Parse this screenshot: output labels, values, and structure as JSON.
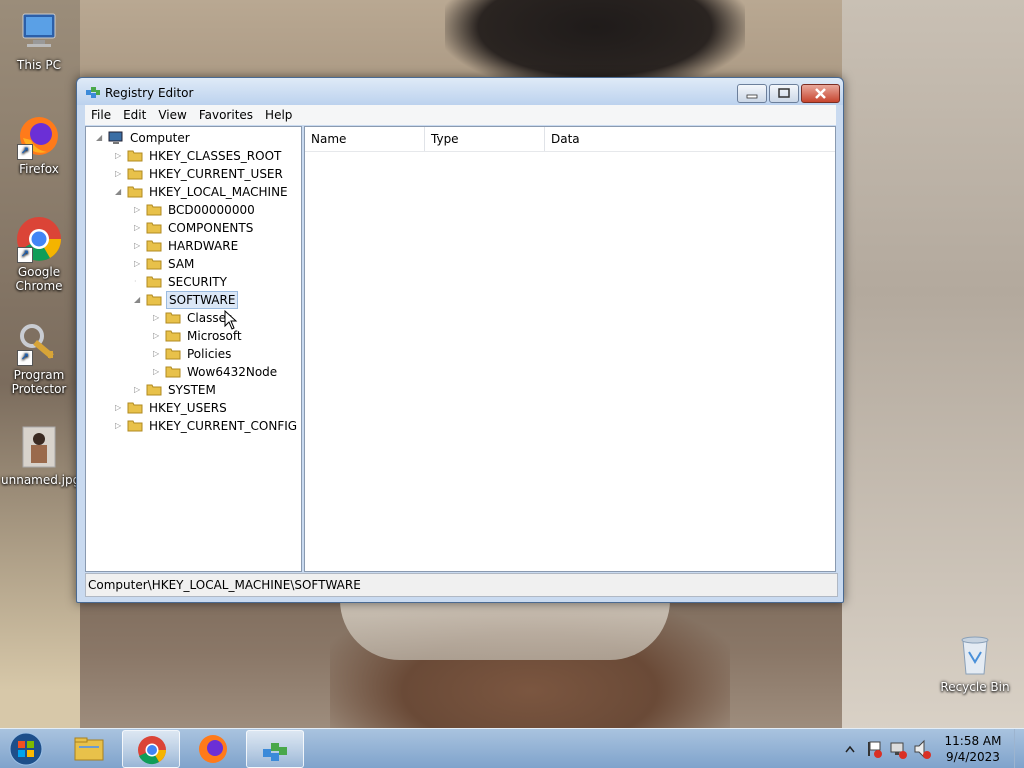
{
  "desktop": {
    "icons": [
      {
        "label": "This PC",
        "icon": "computer-icon"
      },
      {
        "label": "Firefox",
        "icon": "firefox-icon"
      },
      {
        "label": "Google Chrome",
        "icon": "chrome-icon"
      },
      {
        "label": "Program Protector",
        "icon": "key-lock-icon"
      },
      {
        "label": "unnamed.jpg",
        "icon": "image-file-icon"
      },
      {
        "label": "Recycle Bin",
        "icon": "recycle-bin-icon"
      }
    ]
  },
  "window": {
    "title": "Registry Editor",
    "menu": [
      "File",
      "Edit",
      "View",
      "Favorites",
      "Help"
    ],
    "tree": [
      {
        "label": "Computer"
      },
      {
        "label": "HKEY_CLASSES_ROOT"
      },
      {
        "label": "HKEY_CURRENT_USER"
      },
      {
        "label": "HKEY_LOCAL_MACHINE"
      },
      {
        "label": "BCD00000000"
      },
      {
        "label": "COMPONENTS"
      },
      {
        "label": "HARDWARE"
      },
      {
        "label": "SAM"
      },
      {
        "label": "SECURITY"
      },
      {
        "label": "SOFTWARE",
        "selected": true
      },
      {
        "label": "Classes"
      },
      {
        "label": "Microsoft"
      },
      {
        "label": "Policies"
      },
      {
        "label": "Wow6432Node"
      },
      {
        "label": "SYSTEM"
      },
      {
        "label": "HKEY_USERS"
      },
      {
        "label": "HKEY_CURRENT_CONFIG"
      }
    ],
    "columns": [
      "Name",
      "Type",
      "Data"
    ],
    "status": "Computer\\HKEY_LOCAL_MACHINE\\SOFTWARE"
  },
  "taskbar": {
    "apps": [
      "file-explorer-icon",
      "chrome-icon",
      "firefox-icon",
      "registry-editor-icon"
    ],
    "clock_time": "11:58 AM",
    "clock_date": "9/4/2023"
  },
  "colors": {
    "accent": "#3a6ea5",
    "selection": "#dbe7f6",
    "folder": "#e8c14a"
  }
}
